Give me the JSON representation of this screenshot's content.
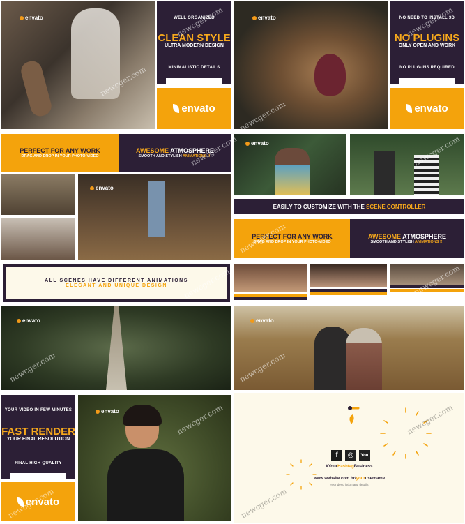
{
  "watermark": "newcger.com",
  "panel1": {
    "logo": "envato",
    "top_label": "WELL ORGANIZED",
    "title": "CLEAN STYLE",
    "subtitle": "ULTRA MODERN DESIGN",
    "bottom_label": "MINIMALISTIC DETAILS",
    "brand": "envato"
  },
  "panel2": {
    "logo": "envato",
    "top_label": "NO NEED TO INSTALL 3D",
    "title": "NO PLUGINS",
    "subtitle": "ONLY OPEN AND WORK",
    "bottom_label": "NO PLUG-INS REQUIRED",
    "brand": "envato"
  },
  "panel3": {
    "banner1_title": "PERFECT FOR ANY WORK",
    "banner1_sub": "DRAG AND DROP IN YOUR PHOTO-VIDEO",
    "banner2_title_a": "AWESOME",
    "banner2_title_b": "ATMOSPHERE",
    "banner2_sub_a": "SMOOTH AND STYLISH",
    "banner2_sub_b": "ANIMATIONS !!!",
    "logo": "envato"
  },
  "panel4": {
    "logo": "envato",
    "strip_a": "EASILY TO CUSTOMIZE",
    "strip_b": "WITH THE",
    "strip_c": "SCENE CONTROLLER",
    "banner1_title": "PERFECT FOR ANY WORK",
    "banner1_sub": "DRAG AND DROP IN YOUR PHOTO-VIDEO",
    "banner2_title_a": "AWESOME",
    "banner2_title_b": "ATMOSPHERE",
    "banner2_sub_a": "SMOOTH AND STYLISH",
    "banner2_sub_b": "ANIMATIONS !!!"
  },
  "panel5": {
    "line1": "ALL SCENES HAVE DIFFERENT ANIMATIONS",
    "line2": "ELEGANT AND UNIQUE DESIGN",
    "logo": "envato"
  },
  "panel6": {
    "logo": "envato"
  },
  "panel7": {
    "top_label": "YOUR VIDEO IN FEW MINUTES",
    "title": "FAST RENDER",
    "subtitle": "YOUR FINAL RESOLUTION",
    "bottom_label": "FINAL HIGH QUALITY",
    "brand": "envato",
    "logo": "envato"
  },
  "panel8": {
    "social_f": "f",
    "social_ig": "◎",
    "social_yt": "You",
    "hashtag_a": "#Your",
    "hashtag_b": "Hashtag",
    "hashtag_c": "Business",
    "website_a": "www.website.com.br/",
    "website_b": "your",
    "website_c": "username",
    "description": "Your description and details"
  },
  "colors": {
    "orange": "#f4a30c",
    "dark_purple": "#2c1f36",
    "cream": "#fdf9ea"
  }
}
